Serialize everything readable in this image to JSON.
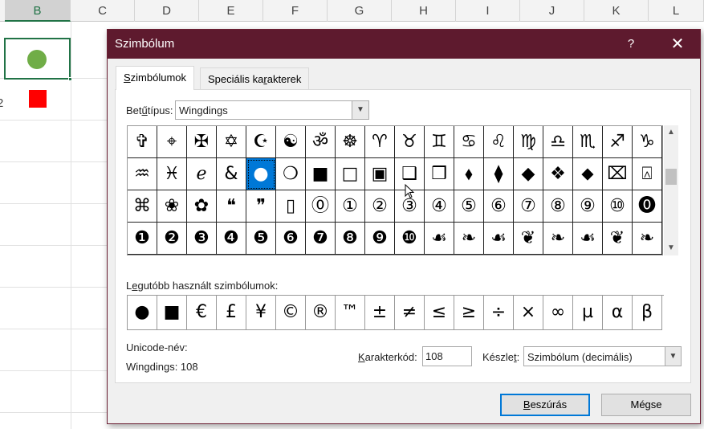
{
  "sheet": {
    "columns": [
      "B",
      "C",
      "D",
      "E",
      "F",
      "G",
      "H",
      "I",
      "J",
      "K",
      "L"
    ],
    "selected_column": "B",
    "row_numbers": [
      "",
      "2"
    ],
    "shape_colors": {
      "circle": "#70ad47",
      "square": "#ff0000"
    }
  },
  "dialog": {
    "title": "Szimbólum",
    "help": "?",
    "close": "✕",
    "tabs": [
      {
        "label_pre": "",
        "label_key": "S",
        "label_post": "zimbólumok",
        "active": true
      },
      {
        "label_pre": "Speciális ka",
        "label_key": "r",
        "label_post": "akterek",
        "active": false
      }
    ],
    "font": {
      "label_pre": "Bet",
      "label_key": "ű",
      "label_post": "típus:",
      "value": "Wingdings"
    },
    "symbols": [
      [
        "✞",
        "⌖",
        "✠",
        "✡",
        "☪",
        "☯",
        "ॐ",
        "☸",
        "♈",
        "♉",
        "♊",
        "♋",
        "♌",
        "♍",
        "♎",
        "♏",
        "♐",
        "♑"
      ],
      [
        "♒",
        "♓",
        "ℯ",
        "&",
        "●",
        "❍",
        "■",
        "□",
        "▣",
        "❑",
        "❒",
        "⬧",
        "⧫",
        "◆",
        "❖",
        "⬥",
        "⌧",
        "⍓"
      ],
      [
        "⌘",
        "❀",
        "✿",
        "❝",
        "❞",
        "▯",
        "⓪",
        "①",
        "②",
        "③",
        "④",
        "⑤",
        "⑥",
        "⑦",
        "⑧",
        "⑨",
        "⑩",
        "⓿"
      ],
      [
        "❶",
        "❷",
        "❸",
        "❹",
        "❺",
        "❻",
        "❼",
        "❽",
        "❾",
        "❿",
        "☙",
        "❧",
        "☙",
        "❦",
        "❧",
        "☙",
        "❦",
        "❧"
      ]
    ],
    "selected": {
      "row": 1,
      "col": 4
    },
    "recent_label_pre": "L",
    "recent_label_key": "e",
    "recent_label_post": "gutóbb használt szimbólumok:",
    "recent": [
      "●",
      "■",
      "€",
      "£",
      "¥",
      "©",
      "®",
      "™",
      "±",
      "≠",
      "≤",
      "≥",
      "÷",
      "×",
      "∞",
      "µ",
      "α",
      "β"
    ],
    "unicode_name_label": "Unicode-név:",
    "unicode_name_value": "Wingdings: 108",
    "code_label_pre": "",
    "code_label_key": "K",
    "code_label_post": "arakterkód:",
    "code_value": "108",
    "set_label_pre": "Készle",
    "set_label_key": "t",
    "set_label_post": ":",
    "set_value": "Szimbólum (decimális)",
    "insert_pre": "",
    "insert_key": "B",
    "insert_post": "eszúrás",
    "cancel": "Mégse"
  }
}
